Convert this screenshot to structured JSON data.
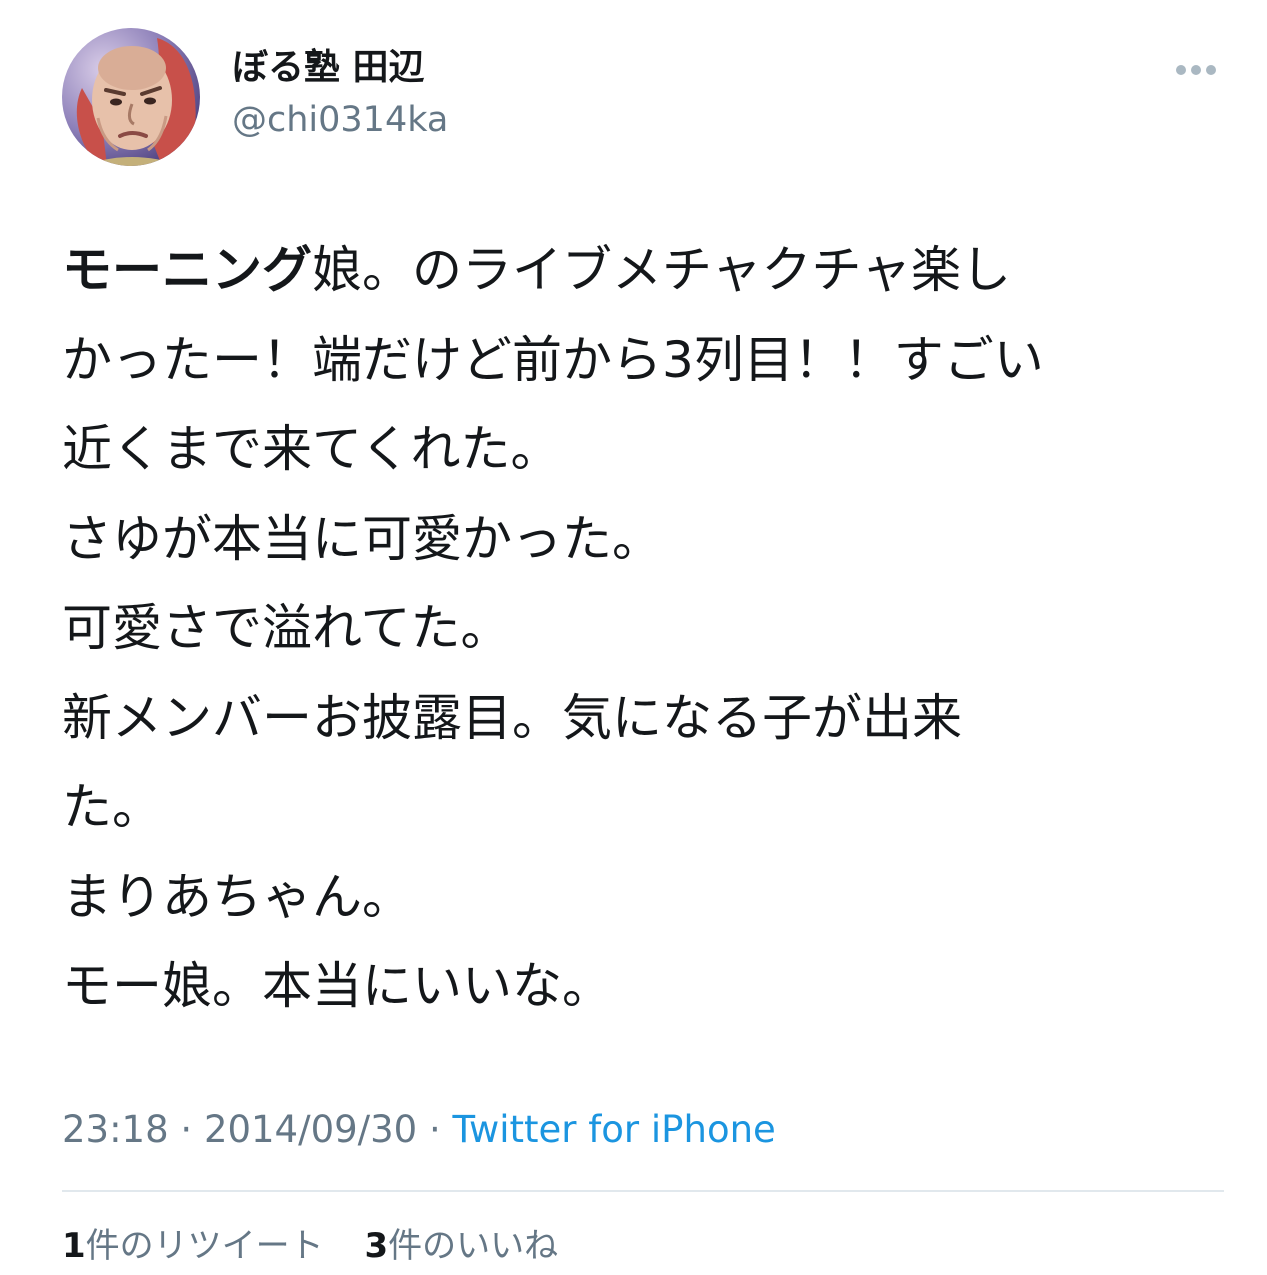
{
  "user": {
    "display_name": "ぼる塾 田辺",
    "handle": "@chi0314ka",
    "avatar_icon": "user-avatar"
  },
  "more_icon": "ellipsis-icon",
  "tweet": {
    "lines": [
      {
        "bold": "モーニング",
        "rest": "娘。のライブメチャクチャ楽し"
      },
      {
        "bold": "",
        "rest": "かったー！端だけど前から3列目！！すごい"
      },
      {
        "bold": "",
        "rest": "近くまで来てくれた。"
      },
      {
        "bold": "",
        "rest": "さゆが本当に可愛かった。"
      },
      {
        "bold": "",
        "rest": "可愛さで溢れてた。"
      },
      {
        "bold": "",
        "rest": "新メンバーお披露目。気になる子が出来"
      },
      {
        "bold": "",
        "rest": "た。"
      },
      {
        "bold": "",
        "rest": "まりあちゃん。"
      },
      {
        "bold": "",
        "rest": "モー娘。本当にいいな。"
      }
    ]
  },
  "meta": {
    "time": "23:18",
    "separator": " · ",
    "date": "2014/09/30",
    "separator2": " · ",
    "source": "Twitter for iPhone"
  },
  "stats": {
    "retweet_count": "1",
    "retweet_label": "件のリツイート",
    "like_count": "3",
    "like_label": "件のいいね"
  },
  "colors": {
    "text": "#14171a",
    "secondary": "#657786",
    "link": "#1b95e0",
    "divider": "#e1e8ed"
  }
}
